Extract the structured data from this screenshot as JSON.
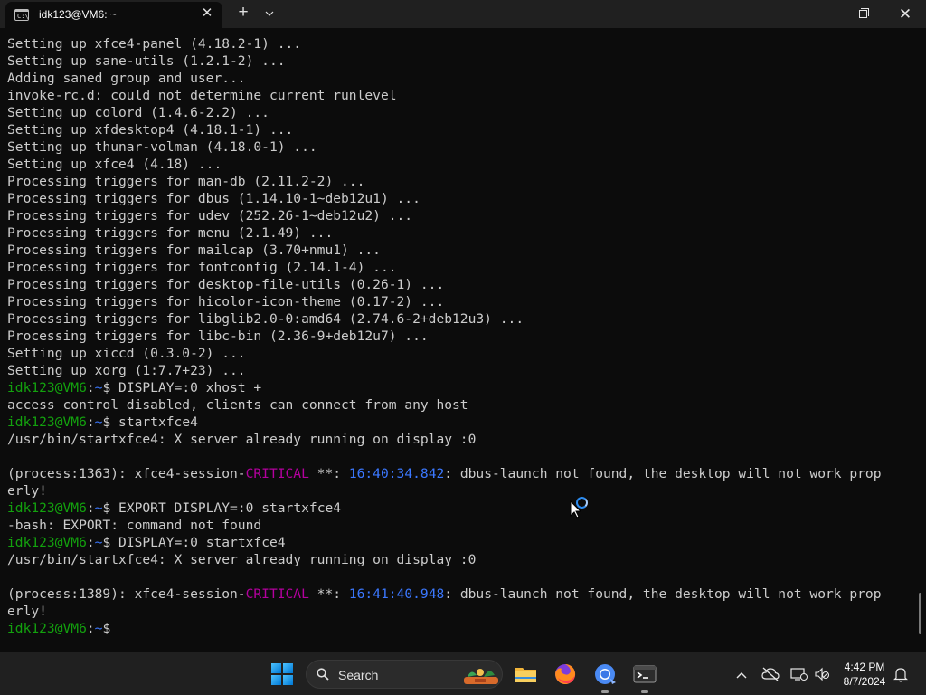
{
  "window": {
    "tab_title": "idk123@VM6: ~",
    "tab_icon_text": "C:\\",
    "close_tab_glyph": "✕",
    "new_tab_glyph": "+",
    "dropdown_glyph": "⌄",
    "minimize_label": "Minimize",
    "maximize_label": "Restore",
    "close_glyph": "✕"
  },
  "terminal": {
    "lines": [
      [
        {
          "t": "Setting up xfce4-panel (4.18.2-1) ...",
          "c": "default"
        }
      ],
      [
        {
          "t": "Setting up sane-utils (1.2.1-2) ...",
          "c": "default"
        }
      ],
      [
        {
          "t": "Adding saned group and user...",
          "c": "default"
        }
      ],
      [
        {
          "t": "invoke-rc.d: could not determine current runlevel",
          "c": "default"
        }
      ],
      [
        {
          "t": "Setting up colord (1.4.6-2.2) ...",
          "c": "default"
        }
      ],
      [
        {
          "t": "Setting up xfdesktop4 (4.18.1-1) ...",
          "c": "default"
        }
      ],
      [
        {
          "t": "Setting up thunar-volman (4.18.0-1) ...",
          "c": "default"
        }
      ],
      [
        {
          "t": "Setting up xfce4 (4.18) ...",
          "c": "default"
        }
      ],
      [
        {
          "t": "Processing triggers for man-db (2.11.2-2) ...",
          "c": "default"
        }
      ],
      [
        {
          "t": "Processing triggers for dbus (1.14.10-1~deb12u1) ...",
          "c": "default"
        }
      ],
      [
        {
          "t": "Processing triggers for udev (252.26-1~deb12u2) ...",
          "c": "default"
        }
      ],
      [
        {
          "t": "Processing triggers for menu (2.1.49) ...",
          "c": "default"
        }
      ],
      [
        {
          "t": "Processing triggers for mailcap (3.70+nmu1) ...",
          "c": "default"
        }
      ],
      [
        {
          "t": "Processing triggers for fontconfig (2.14.1-4) ...",
          "c": "default"
        }
      ],
      [
        {
          "t": "Processing triggers for desktop-file-utils (0.26-1) ...",
          "c": "default"
        }
      ],
      [
        {
          "t": "Processing triggers for hicolor-icon-theme (0.17-2) ...",
          "c": "default"
        }
      ],
      [
        {
          "t": "Processing triggers for libglib2.0-0:amd64 (2.74.6-2+deb12u3) ...",
          "c": "default"
        }
      ],
      [
        {
          "t": "Processing triggers for libc-bin (2.36-9+deb12u7) ...",
          "c": "default"
        }
      ],
      [
        {
          "t": "Setting up xiccd (0.3.0-2) ...",
          "c": "default"
        }
      ],
      [
        {
          "t": "Setting up xorg (1:7.7+23) ...",
          "c": "default"
        }
      ],
      [
        {
          "t": "idk123@VM6",
          "c": "green"
        },
        {
          "t": ":",
          "c": "default"
        },
        {
          "t": "~",
          "c": "blue"
        },
        {
          "t": "$ DISPLAY=:0 xhost +",
          "c": "default"
        }
      ],
      [
        {
          "t": "access control disabled, clients can connect from any host",
          "c": "default"
        }
      ],
      [
        {
          "t": "idk123@VM6",
          "c": "green"
        },
        {
          "t": ":",
          "c": "default"
        },
        {
          "t": "~",
          "c": "blue"
        },
        {
          "t": "$ startxfce4",
          "c": "default"
        }
      ],
      [
        {
          "t": "/usr/bin/startxfce4: X server already running on display :0",
          "c": "default"
        }
      ],
      [
        {
          "t": "",
          "c": "default"
        }
      ],
      [
        {
          "t": "(process:1363): xfce4-session-",
          "c": "default"
        },
        {
          "t": "CRITICAL",
          "c": "magenta"
        },
        {
          "t": " **: ",
          "c": "default"
        },
        {
          "t": "16:40:34.842",
          "c": "blue"
        },
        {
          "t": ": dbus-launch not found, the desktop will not work prop",
          "c": "default"
        }
      ],
      [
        {
          "t": "erly!",
          "c": "default"
        }
      ],
      [
        {
          "t": "idk123@VM6",
          "c": "green"
        },
        {
          "t": ":",
          "c": "default"
        },
        {
          "t": "~",
          "c": "blue"
        },
        {
          "t": "$ EXPORT DISPLAY=:0 startxfce4",
          "c": "default"
        }
      ],
      [
        {
          "t": "-bash: EXPORT: command not found",
          "c": "default"
        }
      ],
      [
        {
          "t": "idk123@VM6",
          "c": "green"
        },
        {
          "t": ":",
          "c": "default"
        },
        {
          "t": "~",
          "c": "blue"
        },
        {
          "t": "$ DISPLAY=:0 startxfce4",
          "c": "default"
        }
      ],
      [
        {
          "t": "/usr/bin/startxfce4: X server already running on display :0",
          "c": "default"
        }
      ],
      [
        {
          "t": "",
          "c": "default"
        }
      ],
      [
        {
          "t": "(process:1389): xfce4-session-",
          "c": "default"
        },
        {
          "t": "CRITICAL",
          "c": "magenta"
        },
        {
          "t": " **: ",
          "c": "default"
        },
        {
          "t": "16:41:40.948",
          "c": "blue"
        },
        {
          "t": ": dbus-launch not found, the desktop will not work prop",
          "c": "default"
        }
      ],
      [
        {
          "t": "erly!",
          "c": "default"
        }
      ],
      [
        {
          "t": "idk123@VM6",
          "c": "green"
        },
        {
          "t": ":",
          "c": "default"
        },
        {
          "t": "~",
          "c": "blue"
        },
        {
          "t": "$ ",
          "c": "default"
        }
      ]
    ]
  },
  "taskbar": {
    "search_placeholder": "Search",
    "apps": [
      {
        "name": "file-explorer-icon"
      },
      {
        "name": "firefox-icon"
      },
      {
        "name": "chrome-icon"
      },
      {
        "name": "terminal-icon"
      }
    ],
    "tray": {
      "overflow_glyph": "^",
      "network_glyph": "⊘",
      "clock_time": "4:42 PM",
      "clock_date": "8/7/2024"
    }
  },
  "colors": {
    "green": "#13a10e",
    "blue": "#3b78ff",
    "magenta": "#b4009e",
    "default": "#cccccc",
    "background": "#0c0c0c"
  }
}
